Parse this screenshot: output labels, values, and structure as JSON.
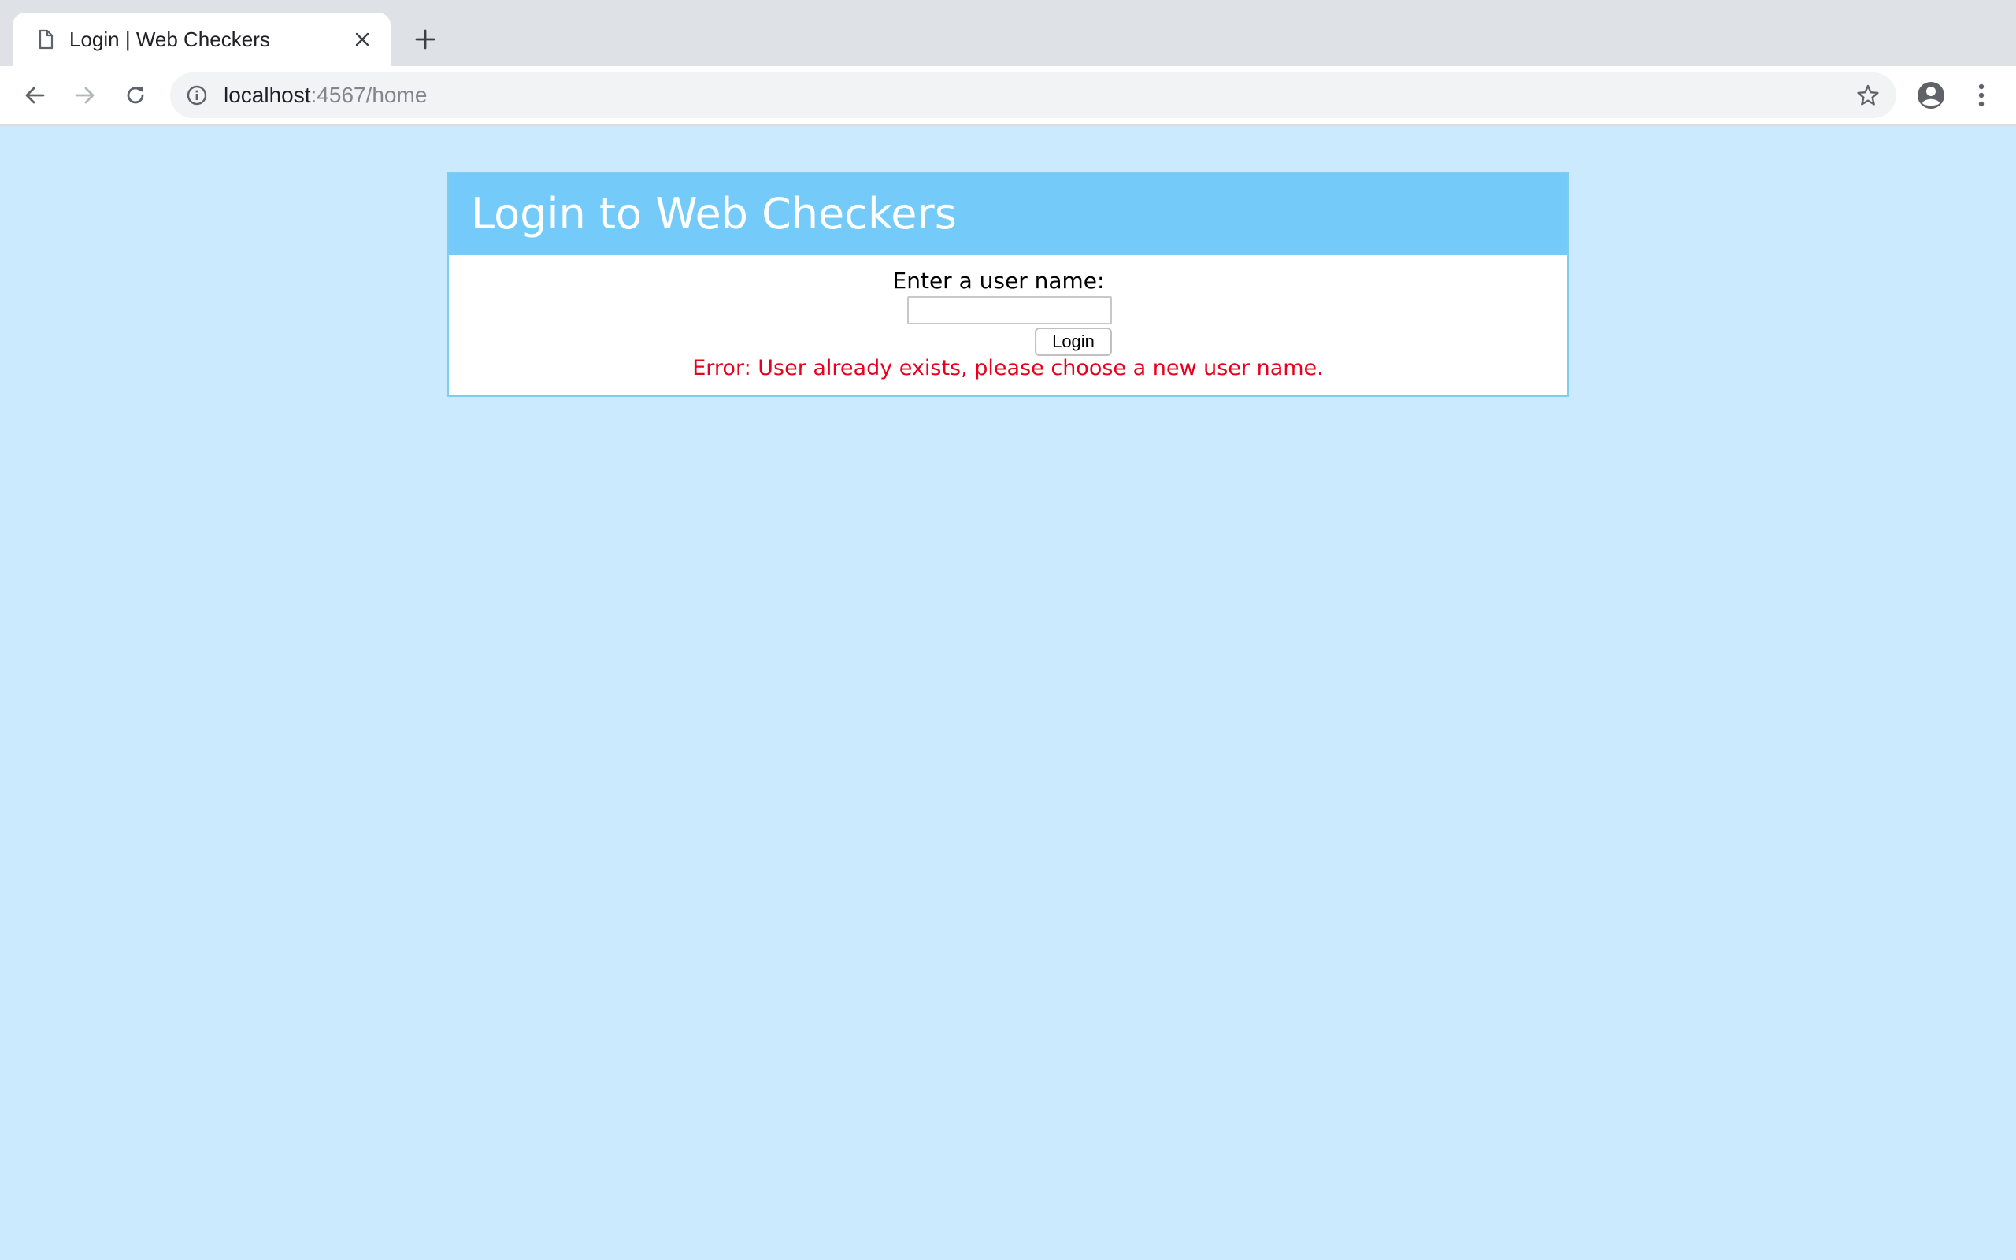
{
  "browser": {
    "tab": {
      "title": "Login | Web Checkers",
      "favicon": "document-icon"
    },
    "address_bar": {
      "host": "localhost",
      "rest": ":4567/home"
    },
    "icons": {
      "back": "arrow-left-icon",
      "forward": "arrow-right-icon",
      "reload": "reload-icon",
      "info": "info-icon",
      "bookmark": "star-icon",
      "profile": "account-circle-icon",
      "menu": "vertical-dots-icon",
      "new_tab": "plus-icon",
      "close_tab": "close-icon"
    }
  },
  "page": {
    "background_color": "#cbeafd",
    "header_color": "#74cbf9",
    "title": "Login to Web Checkers",
    "form": {
      "label": "Enter a user name:",
      "input_value": "",
      "button_label": "Login"
    },
    "error": {
      "text": "Error: User already exists, please choose a new user name.",
      "color": "#e8001c"
    }
  }
}
